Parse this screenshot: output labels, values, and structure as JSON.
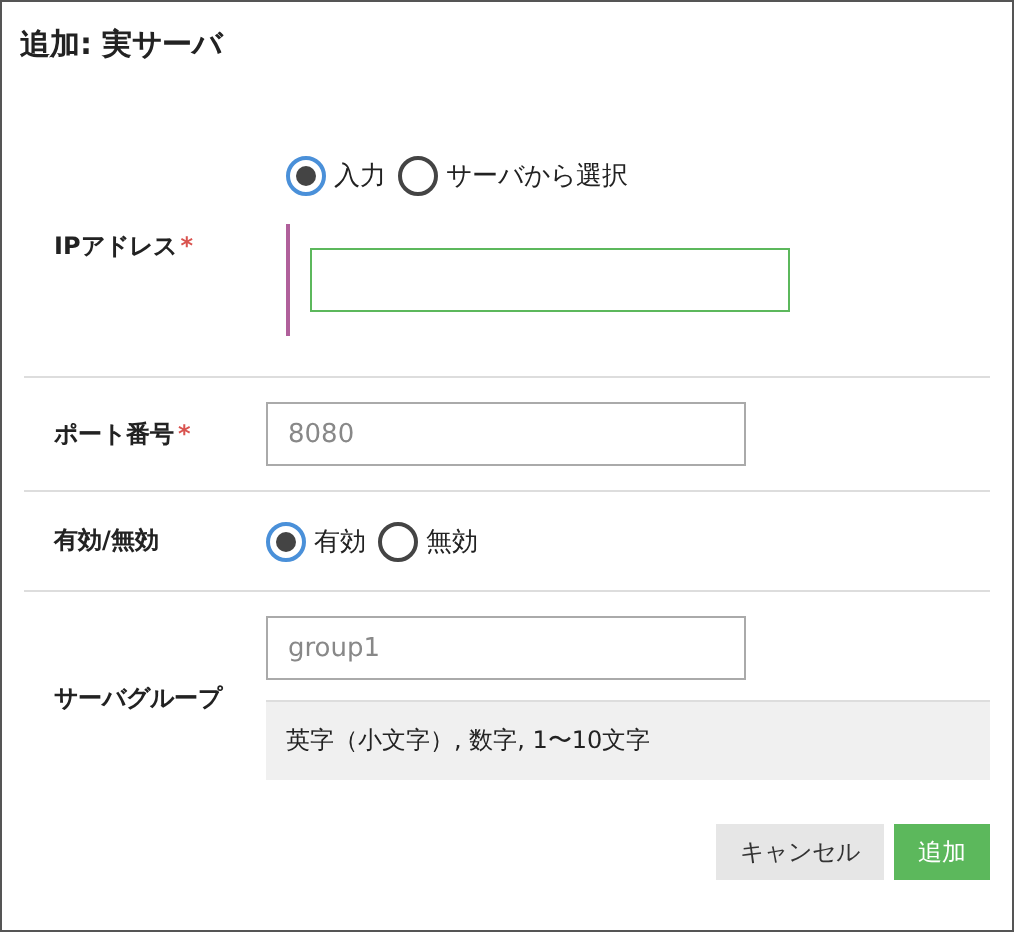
{
  "dialog": {
    "title": "追加: 実サーバ"
  },
  "rows": [
    {
      "kind": "choice-input",
      "label": "IPアドレス",
      "required_mark": "*",
      "options": [
        {
          "label": "入力",
          "selected": true
        },
        {
          "label": "サーバから選択",
          "selected": false
        }
      ]
    },
    {
      "kind": "input",
      "label": "ポート番号",
      "required_mark": "*",
      "placeholder": "8080"
    },
    {
      "kind": "radio",
      "label": "有効/無効",
      "options": [
        {
          "label": "有効",
          "selected": true
        },
        {
          "label": "無効",
          "selected": false
        }
      ]
    },
    {
      "kind": "input-hint",
      "label": "サーバグループ",
      "placeholder": "group1",
      "hint": "英字（小文字）, 数字, 1〜10文字"
    }
  ],
  "buttons": [
    {
      "kind": "secondary",
      "label": "キャンセル"
    },
    {
      "kind": "primary",
      "label": "追加"
    }
  ]
}
